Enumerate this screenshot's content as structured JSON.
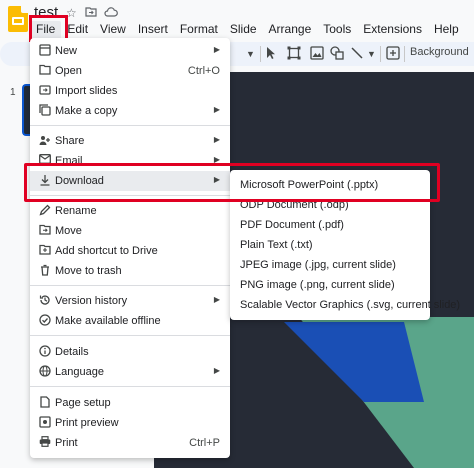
{
  "document": {
    "title": "test"
  },
  "menubar": [
    "File",
    "Edit",
    "View",
    "Insert",
    "Format",
    "Slide",
    "Arrange",
    "Tools",
    "Extensions",
    "Help"
  ],
  "toolbar": {
    "background_label": "Background"
  },
  "slides_panel": {
    "slide_number": "1"
  },
  "file_menu": {
    "items": [
      {
        "label": "New",
        "shortcut": "",
        "submenu": true,
        "icon": "new-icon"
      },
      {
        "label": "Open",
        "shortcut": "Ctrl+O",
        "submenu": false,
        "icon": "folder-icon"
      },
      {
        "label": "Import slides",
        "shortcut": "",
        "submenu": false,
        "icon": "import-icon"
      },
      {
        "label": "Make a copy",
        "shortcut": "",
        "submenu": true,
        "icon": "copy-icon"
      },
      {
        "label": "Share",
        "shortcut": "",
        "submenu": true,
        "icon": "share-icon"
      },
      {
        "label": "Email",
        "shortcut": "",
        "submenu": true,
        "icon": "email-icon"
      },
      {
        "label": "Download",
        "shortcut": "",
        "submenu": true,
        "icon": "download-icon"
      },
      {
        "label": "Rename",
        "shortcut": "",
        "submenu": false,
        "icon": "pencil-icon"
      },
      {
        "label": "Move",
        "shortcut": "",
        "submenu": false,
        "icon": "move-folder-icon"
      },
      {
        "label": "Add shortcut to Drive",
        "shortcut": "",
        "submenu": false,
        "icon": "drive-shortcut-icon"
      },
      {
        "label": "Move to trash",
        "shortcut": "",
        "submenu": false,
        "icon": "trash-icon"
      },
      {
        "label": "Version history",
        "shortcut": "",
        "submenu": true,
        "icon": "history-icon"
      },
      {
        "label": "Make available offline",
        "shortcut": "",
        "submenu": false,
        "icon": "offline-icon"
      },
      {
        "label": "Details",
        "shortcut": "",
        "submenu": false,
        "icon": "info-icon"
      },
      {
        "label": "Language",
        "shortcut": "",
        "submenu": true,
        "icon": "globe-icon"
      },
      {
        "label": "Page setup",
        "shortcut": "",
        "submenu": false,
        "icon": "page-icon"
      },
      {
        "label": "Print preview",
        "shortcut": "",
        "submenu": false,
        "icon": "preview-icon"
      },
      {
        "label": "Print",
        "shortcut": "Ctrl+P",
        "submenu": false,
        "icon": "printer-icon"
      }
    ]
  },
  "download_menu": {
    "items": [
      "Microsoft PowerPoint (.pptx)",
      "ODP Document (.odp)",
      "PDF Document (.pdf)",
      "Plain Text (.txt)",
      "JPEG image (.jpg, current slide)",
      "PNG image (.png, current slide)",
      "Scalable Vector Graphics (.svg, current slide)"
    ]
  },
  "colors": {
    "highlight": "#e00022",
    "slide_dark": "#262b36",
    "slide_blue": "#1a4fb5",
    "slide_teal": "#5aa58a"
  }
}
